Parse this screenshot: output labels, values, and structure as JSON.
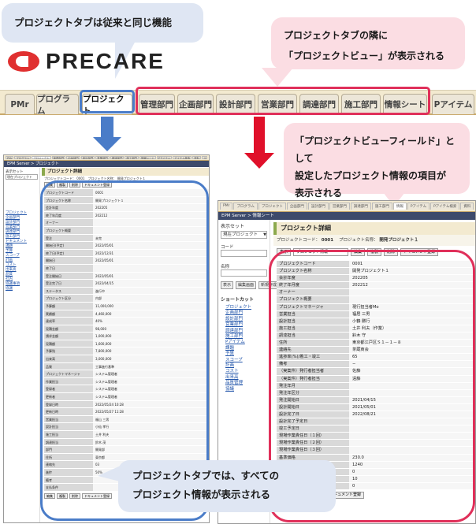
{
  "callouts": {
    "top_left": "プロジェクトタブは従来と同じ機能",
    "top_right_1": "プロジェクトタブの隣に",
    "top_right_2": "「プロジェクトビュー」が表示される",
    "mid_right_1": "「プロジェクトビューフィールド」として",
    "mid_right_2": "設定したプロジェクト情報の項目が",
    "mid_right_3": "表示される",
    "bottom_1": "プロジェクトタブでは、すべての",
    "bottom_2": "プロジェクト情報が表示される"
  },
  "logo_text": "PRECARE",
  "tabs": [
    "PMr",
    "プログラム",
    "プロジェクト",
    "管理部門",
    "企画部門",
    "設計部門",
    "営業部門",
    "調達部門",
    "施工部門",
    "情報シート",
    "Pアイテム"
  ],
  "colors": {
    "blue": "#4a7cc8",
    "pink": "#e0305a",
    "red_arrow": "#e0102a"
  },
  "left_shot": {
    "tabs": [
      "PMr",
      "プログラム",
      "プロジェクト",
      "管理部門",
      "企画部門",
      "設計部門",
      "営業部門",
      "調達部門",
      "施工部門",
      "情報シート",
      "Pアイテム",
      "アイテム検索",
      "資料",
      "スケジュール",
      "ログ"
    ],
    "breadcrumb": "EPM Server > プロジェクト",
    "shortcut_label": "表示セット",
    "shortcut_value": "現在プロジェクト",
    "title": "プロジェクト詳細",
    "meta": "プロジェクトコード： 0001　プロジェクト名称： 開発プロジェクト１",
    "side_links": [
      "プロジェクト",
      "企画部門",
      "設計部門",
      "営業部門",
      "調達部門",
      "施工部門",
      "ドキュメント",
      "課題",
      "予算",
      "スコープ",
      "計画",
      "コスト",
      "出来高",
      "品質",
      "社内",
      "協議事項",
      "協議"
    ],
    "rows": [
      [
        "プロジェクトコード",
        "0001"
      ],
      [
        "プロジェクト名称",
        "開発プロジェクト１"
      ],
      [
        "会計年度",
        "202205"
      ],
      [
        "終了年月度",
        "202212"
      ],
      [
        "オーナー",
        ""
      ],
      [
        "プロジェクト概要",
        ""
      ],
      [
        "受注",
        "未完"
      ],
      [
        "開始日(予定)",
        "2022/05/01"
      ],
      [
        "終了日(予定)",
        "2022/12/31"
      ],
      [
        "開始日",
        "2022/05/01"
      ],
      [
        "終了日",
        ""
      ],
      [
        "受注開始日",
        "2022/05/01"
      ],
      [
        "受注完了日",
        "2022/04/15"
      ],
      [
        "ステータス",
        "進行中"
      ],
      [
        "プロジェクト区分",
        "内部"
      ],
      [
        "予算額",
        "11,000,000"
      ],
      [
        "実績額",
        "4,460,000"
      ],
      [
        "達成率",
        "40%"
      ],
      [
        "見積金額",
        "98,000"
      ],
      [
        "請求金額",
        "1,000,000"
      ],
      [
        "見積額",
        "1,600,000"
      ],
      [
        "予算残",
        "7,800,000"
      ],
      [
        "出来高",
        "3,000,000"
      ],
      [
        "品質",
        "工事進行基準"
      ],
      [
        "プロジェクトマネージャ",
        "システム管理者"
      ],
      [
        "作業担当",
        "システム管理者"
      ],
      [
        "登録者",
        "システム管理者"
      ],
      [
        "更新者",
        "システム管理者"
      ],
      [
        "登録日時",
        "2022/05/24 10:28"
      ],
      [
        "更新日時",
        "2022/05/27 11:28"
      ],
      [
        "営業担当",
        "福山 三男"
      ],
      [
        "設計担当",
        "小仙 孝行"
      ],
      [
        "施工担当",
        "土井 利夫"
      ],
      [
        "調達担当",
        "鈴木 茂"
      ],
      [
        "部門",
        "開発部"
      ],
      [
        "住所",
        "東京都"
      ],
      [
        "連絡先",
        "03"
      ],
      [
        "進捗",
        "50%"
      ],
      [
        "備考",
        ""
      ],
      [
        "支払条件",
        ""
      ]
    ],
    "buttons": [
      "編集",
      "複製",
      "削除",
      "ドキュメント登録"
    ]
  },
  "right_shot": {
    "tabs": [
      "PMr",
      "プログラム",
      "プロジェクト",
      "企画部門",
      "設計部門",
      "営業部門",
      "調達部門",
      "施工部門",
      "情報",
      "Pアイテム",
      "Pアイテム検索",
      "資料",
      "スケジュール"
    ],
    "breadcrumb": "EPM Server > 情報シート",
    "shortcut_label": "表示セット",
    "shortcut_value": "現在プロジェクト",
    "code_label": "コード",
    "name_label": "名称",
    "side_buttons": [
      "表示",
      "編集画面",
      "新規作成"
    ],
    "shortcut_title": "ショートカット",
    "side_links": [
      "プロジェクト",
      "企画部門",
      "設計部門",
      "営業部門",
      "調達部門",
      "施工部門",
      "Pアイテム",
      "課題",
      "予算",
      "スコープ",
      "計画",
      "コスト",
      "出来高",
      "品質管理",
      "協議"
    ],
    "title": "プロジェクト詳細",
    "meta_code_label": "プロジェクトコード：",
    "meta_code": "0001",
    "meta_name_label": "プロジェクト名称：",
    "meta_name": "開発プロジェクト１",
    "select_value": "プロジェクト情報",
    "top_buttons": [
      "表示",
      "編集",
      "複製",
      "削除",
      "ドキュメント登録"
    ],
    "rows": [
      [
        "プロジェクトコード",
        "0001"
      ],
      [
        "プロジェクト名称",
        "開発プロジェクト１"
      ],
      [
        "会計年度",
        "202205"
      ],
      [
        "終了年月度",
        "202212"
      ],
      [
        "オーナー",
        ""
      ],
      [
        "プロジェクト概要",
        ""
      ],
      [
        "プロジェクトマネージャ",
        "現行担当者Mo"
      ],
      [
        "営業担当",
        "福居 三男"
      ],
      [
        "設計担当",
        "小鶴 勝行"
      ],
      [
        "施工担当",
        "土井 利夫（作業）"
      ],
      [
        "調達担当",
        "鈴木 守"
      ],
      [
        "住所",
        "東京都江戸区Ｓ１－１－８"
      ],
      [
        "連絡先",
        "茶蔵商会"
      ],
      [
        "進捗率(%)/着工・竣工",
        "65"
      ],
      [
        "備考",
        "−"
      ],
      [
        "（実案件）発行者担当者",
        "佐藤"
      ],
      [
        "（実案件）発行者担当",
        "遠藤"
      ],
      [
        "発注年月",
        ""
      ],
      [
        "発注年区分",
        ""
      ],
      [
        "発注開始日",
        "2021/04/15"
      ],
      [
        "設計開始日",
        "2021/05/01"
      ],
      [
        "設計完了日",
        "2022/08/21"
      ],
      [
        "設計完了予定日",
        ""
      ],
      [
        "竣工予定日",
        ""
      ],
      [
        "現場作業責任日（１回）",
        ""
      ],
      [
        "現場作業責任日（２回）",
        ""
      ],
      [
        "現場作業責任日（３回）",
        ""
      ],
      [
        "基準価格",
        "230.0"
      ],
      [
        "受入面積",
        "1240"
      ],
      [
        "建築面積",
        "0"
      ],
      [
        "階数",
        "10"
      ],
      [
        "現金購入金額（百万円）",
        "0"
      ]
    ],
    "bottom_buttons": [
      "編集",
      "複製",
      "削除",
      "ドキュメント登録"
    ]
  }
}
